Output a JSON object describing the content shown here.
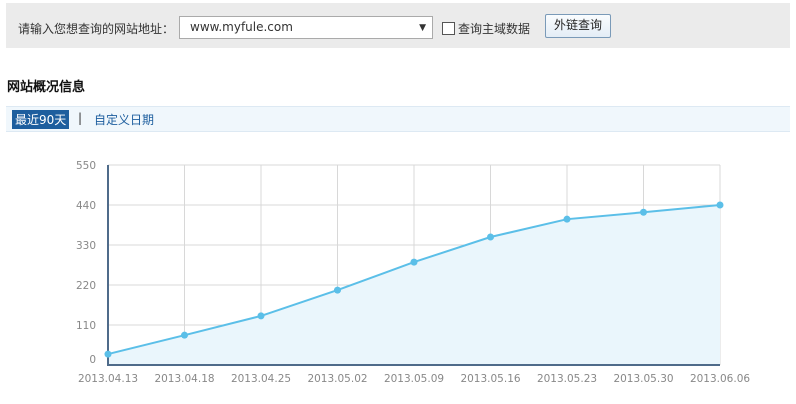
{
  "search": {
    "label": "请输入您想查询的网站地址：",
    "value": "www.myfule.com",
    "checkbox_label": "查询主域数据",
    "checkbox_checked": false,
    "button": "外链查询"
  },
  "section_title": "网站概况信息",
  "tabs": [
    {
      "label": "最近90天",
      "active": true
    },
    {
      "separator": "|"
    },
    {
      "label": "自定义日期",
      "active": false
    }
  ],
  "colors": {
    "line": "#5bbfe8",
    "fill": "#eaf6fc",
    "axis": "#4f6b8a",
    "tab_active": "#1d5e9e"
  },
  "chart_data": {
    "type": "area",
    "categories": [
      "2013.04.13",
      "2013.04.18",
      "2013.04.25",
      "2013.05.02",
      "2013.05.09",
      "2013.05.16",
      "2013.05.23",
      "2013.05.30",
      "2013.06.06"
    ],
    "values": [
      30,
      82,
      135,
      206,
      283,
      352,
      401,
      420,
      440
    ],
    "ylim": [
      0,
      550
    ],
    "yticks": [
      0,
      110,
      220,
      330,
      440,
      550
    ],
    "grid": true
  }
}
